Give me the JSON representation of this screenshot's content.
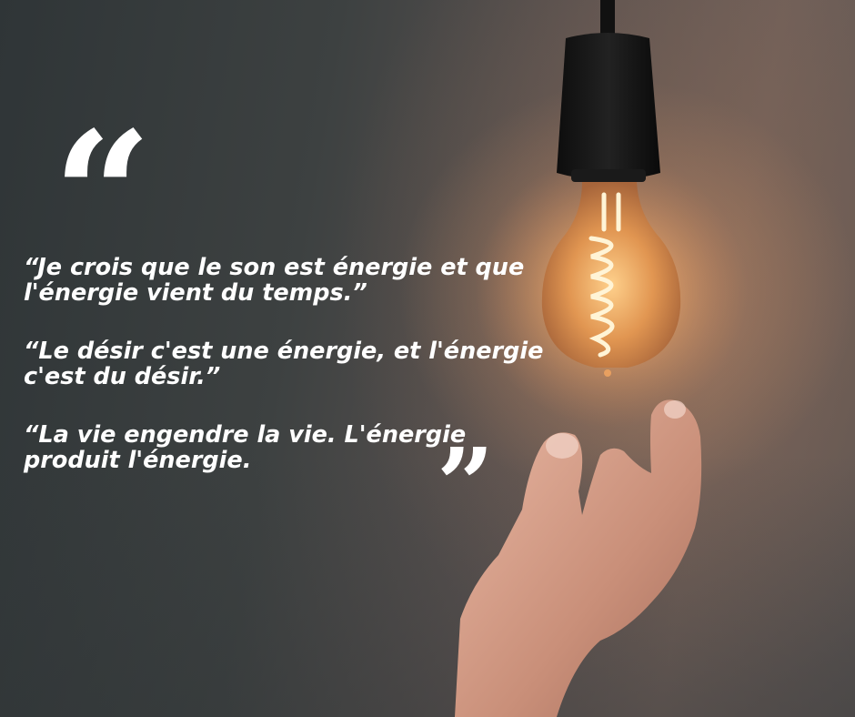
{
  "quotes": [
    {
      "lines": [
        "“Je crois que le son est énergie et que",
        "l'énergie vient du temps.”"
      ]
    },
    {
      "lines": [
        "“Le désir c'est une énergie, et l'énergie",
        "c'est du désir.”"
      ]
    },
    {
      "lines": [
        "“La vie engendre la vie. L'énergie",
        "produit l'énergie."
      ]
    }
  ],
  "decor": {
    "open_quote_mark": "“",
    "close_quote_mark": "”"
  },
  "colors": {
    "text": "#ffffff",
    "background_dark": "#2f3537",
    "glow": "#f3b87a"
  }
}
